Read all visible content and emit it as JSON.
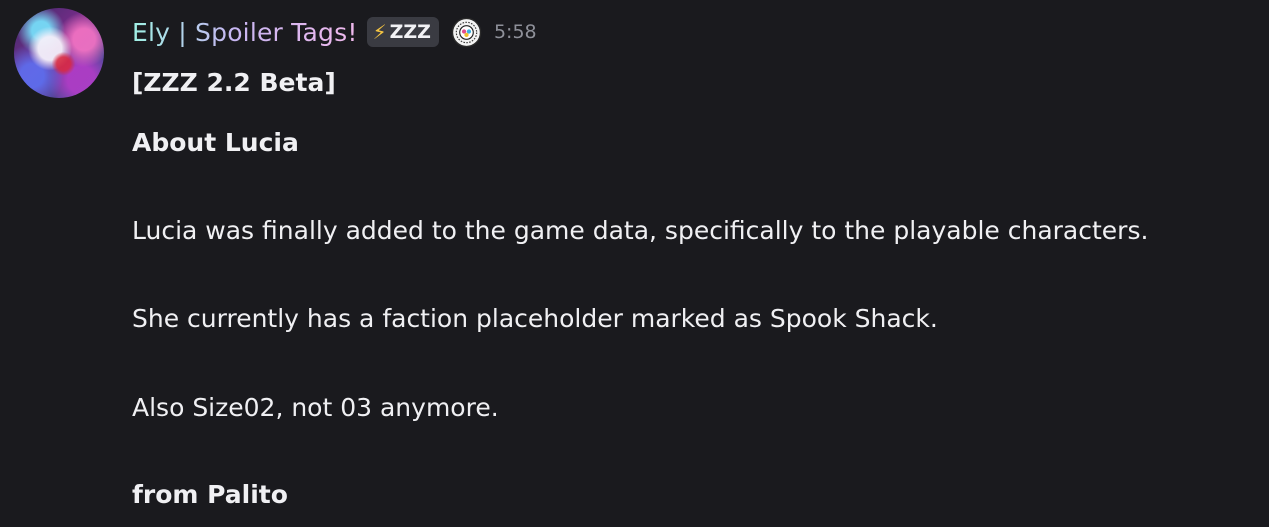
{
  "message": {
    "username": "Ely | Spoiler Tags!",
    "tag": {
      "icon": "lightning-bolt-icon",
      "symbol": "⚡",
      "label": "ZZZ"
    },
    "badge_icon": "circular-badge-icon",
    "timestamp": "5:58",
    "lines": [
      "[ZZZ 2.2 Beta]",
      "About Lucia",
      "Lucia was finally added to the game data, specifically to the playable characters.",
      "She currently has a faction placeholder marked as Spook Shack.",
      "Also Size02, not 03 anymore.",
      "from Palito"
    ]
  },
  "colors": {
    "background": "#1a1a1e",
    "text": "#f0f0f3",
    "timestamp": "#8e9099",
    "tag_background": "#3a3b42",
    "username_gradient": [
      "#9ff0e4",
      "#c7b6f2",
      "#f0b8ec"
    ]
  }
}
